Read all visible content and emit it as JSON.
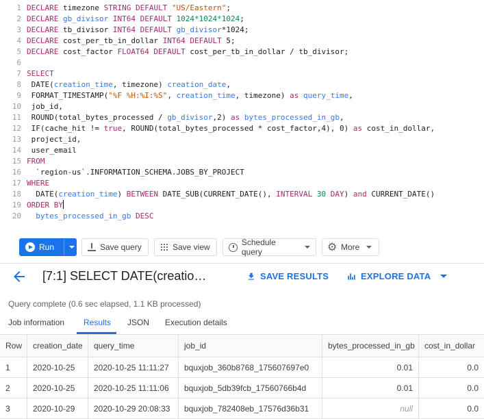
{
  "editor": {
    "lines": [
      {
        "n": "1",
        "tokens": [
          {
            "t": "kw",
            "v": "DECLARE"
          },
          {
            "t": "txt",
            "v": " timezone "
          },
          {
            "t": "kw",
            "v": "STRING DEFAULT"
          },
          {
            "t": "txt",
            "v": " "
          },
          {
            "t": "str",
            "v": "\"US/Eastern\""
          },
          {
            "t": "txt",
            "v": ";"
          }
        ]
      },
      {
        "n": "2",
        "tokens": [
          {
            "t": "kw",
            "v": "DECLARE"
          },
          {
            "t": "txt",
            "v": " "
          },
          {
            "t": "var",
            "v": "gb_divisor"
          },
          {
            "t": "txt",
            "v": " "
          },
          {
            "t": "kw",
            "v": "INT64 DEFAULT"
          },
          {
            "t": "txt",
            "v": " "
          },
          {
            "t": "num",
            "v": "1024*1024*1024"
          },
          {
            "t": "txt",
            "v": ";"
          }
        ]
      },
      {
        "n": "3",
        "tokens": [
          {
            "t": "kw",
            "v": "DECLARE"
          },
          {
            "t": "txt",
            "v": " tb_divisor "
          },
          {
            "t": "kw",
            "v": "INT64 DEFAULT"
          },
          {
            "t": "txt",
            "v": " "
          },
          {
            "t": "var",
            "v": "gb_divisor"
          },
          {
            "t": "txt",
            "v": "*1024;"
          }
        ]
      },
      {
        "n": "4",
        "tokens": [
          {
            "t": "kw",
            "v": "DECLARE"
          },
          {
            "t": "txt",
            "v": " cost_per_tb_in_dollar "
          },
          {
            "t": "kw",
            "v": "INT64 DEFAULT"
          },
          {
            "t": "txt",
            "v": " 5;"
          }
        ]
      },
      {
        "n": "5",
        "tokens": [
          {
            "t": "kw",
            "v": "DECLARE"
          },
          {
            "t": "txt",
            "v": " cost_factor "
          },
          {
            "t": "kw",
            "v": "FLOAT64 DEFAULT"
          },
          {
            "t": "txt",
            "v": " cost_per_tb_in_dollar / tb_divisor;"
          }
        ]
      },
      {
        "n": "6",
        "tokens": []
      },
      {
        "n": "7",
        "tokens": [
          {
            "t": "kw",
            "v": "SELECT"
          }
        ]
      },
      {
        "n": "8",
        "tokens": [
          {
            "t": "txt",
            "v": " DATE("
          },
          {
            "t": "var",
            "v": "creation_time"
          },
          {
            "t": "txt",
            "v": ", timezone) "
          },
          {
            "t": "var",
            "v": "creation_date"
          },
          {
            "t": "txt",
            "v": ","
          }
        ]
      },
      {
        "n": "9",
        "tokens": [
          {
            "t": "txt",
            "v": " FORMAT_TIMESTAMP("
          },
          {
            "t": "str",
            "v": "\"%F %H:%I:%S\""
          },
          {
            "t": "txt",
            "v": ", "
          },
          {
            "t": "var",
            "v": "creation_time"
          },
          {
            "t": "txt",
            "v": ", timezone) "
          },
          {
            "t": "kw",
            "v": "as"
          },
          {
            "t": "txt",
            "v": " "
          },
          {
            "t": "var",
            "v": "query_time"
          },
          {
            "t": "txt",
            "v": ","
          }
        ]
      },
      {
        "n": "10",
        "tokens": [
          {
            "t": "txt",
            "v": " job_id,"
          }
        ]
      },
      {
        "n": "11",
        "tokens": [
          {
            "t": "txt",
            "v": " ROUND(total_bytes_processed / "
          },
          {
            "t": "var",
            "v": "gb_divisor"
          },
          {
            "t": "txt",
            "v": ",2) "
          },
          {
            "t": "kw",
            "v": "as"
          },
          {
            "t": "txt",
            "v": " "
          },
          {
            "t": "var",
            "v": "bytes_processed_in_gb"
          },
          {
            "t": "txt",
            "v": ","
          }
        ]
      },
      {
        "n": "12",
        "tokens": [
          {
            "t": "txt",
            "v": " IF(cache_hit != "
          },
          {
            "t": "kw",
            "v": "true"
          },
          {
            "t": "txt",
            "v": ", ROUND(total_bytes_processed * cost_factor,4), 0) "
          },
          {
            "t": "kw",
            "v": "as"
          },
          {
            "t": "txt",
            "v": " cost_in_dollar,"
          }
        ]
      },
      {
        "n": "13",
        "tokens": [
          {
            "t": "txt",
            "v": " project_id,"
          }
        ]
      },
      {
        "n": "14",
        "tokens": [
          {
            "t": "txt",
            "v": " user_email"
          }
        ]
      },
      {
        "n": "15",
        "tokens": [
          {
            "t": "kw",
            "v": "FROM"
          }
        ]
      },
      {
        "n": "16",
        "tokens": [
          {
            "t": "txt",
            "v": "  `region-us`.INFORMATION_SCHEMA.JOBS_BY_PROJECT"
          }
        ]
      },
      {
        "n": "17",
        "tokens": [
          {
            "t": "kw",
            "v": "WHERE"
          }
        ]
      },
      {
        "n": "18",
        "tokens": [
          {
            "t": "txt",
            "v": "  DATE("
          },
          {
            "t": "var",
            "v": "creation_time"
          },
          {
            "t": "txt",
            "v": ") "
          },
          {
            "t": "kw",
            "v": "BETWEEN"
          },
          {
            "t": "txt",
            "v": " DATE_SUB(CURRENT_DATE(), "
          },
          {
            "t": "kw",
            "v": "INTERVAL"
          },
          {
            "t": "txt",
            "v": " "
          },
          {
            "t": "num",
            "v": "30"
          },
          {
            "t": "txt",
            "v": " "
          },
          {
            "t": "kw",
            "v": "DAY"
          },
          {
            "t": "txt",
            "v": ") "
          },
          {
            "t": "kw",
            "v": "and"
          },
          {
            "t": "txt",
            "v": " CURRENT_DATE()"
          }
        ]
      },
      {
        "n": "19",
        "tokens": [
          {
            "t": "kw",
            "v": "ORDER BY"
          }
        ],
        "cursor": true
      },
      {
        "n": "20",
        "tokens": [
          {
            "t": "txt",
            "v": "  "
          },
          {
            "t": "var",
            "v": "bytes_processed_in_gb"
          },
          {
            "t": "txt",
            "v": " "
          },
          {
            "t": "kw",
            "v": "DESC"
          }
        ]
      }
    ]
  },
  "toolbar": {
    "run_label": "Run",
    "save_query_label": "Save query",
    "save_view_label": "Save view",
    "schedule_query_label": "Schedule query",
    "more_label": "More"
  },
  "results": {
    "title": "[7:1] SELECT DATE(creatio…",
    "save_results_label": "SAVE RESULTS",
    "explore_data_label": "EXPLORE DATA",
    "status": "Query complete (0.6 sec elapsed, 1.1 KB processed)"
  },
  "tabs": [
    {
      "label": "Job information",
      "active": false
    },
    {
      "label": "Results",
      "active": true
    },
    {
      "label": "JSON",
      "active": false
    },
    {
      "label": "Execution details",
      "active": false
    }
  ],
  "table": {
    "headers": [
      "Row",
      "creation_date",
      "query_time",
      "job_id",
      "bytes_processed_in_gb",
      "cost_in_dollar"
    ],
    "rows": [
      [
        "1",
        "2020-10-25",
        "2020-10-25 11:11:27",
        "bquxjob_360b8768_175607697e0",
        "0.01",
        "0.0"
      ],
      [
        "2",
        "2020-10-25",
        "2020-10-25 11:11:06",
        "bquxjob_5db39fcb_17560766b4d",
        "0.01",
        "0.0"
      ],
      [
        "3",
        "2020-10-29",
        "2020-10-29 20:08:33",
        "bquxjob_782408eb_17576d36b31",
        "null",
        "0.0"
      ]
    ]
  },
  "colors": {
    "accent": "#1a73e8",
    "keyword": "#a52a6e",
    "variable": "#3b78e7"
  }
}
